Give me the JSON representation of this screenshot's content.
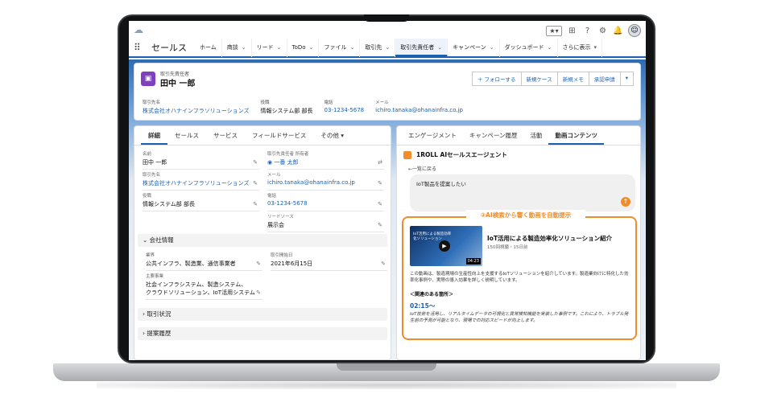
{
  "app": {
    "name": "セールス",
    "nav": [
      "ホーム",
      "商談",
      "リード",
      "ToDo",
      "ファイル",
      "取引先",
      "取引先責任者",
      "キャンペーン",
      "ダッシュボード",
      "さらに表示"
    ],
    "active_nav": "取引先責任者"
  },
  "record": {
    "type": "取引先責任者",
    "name": "田中 一郎",
    "buttons": [
      "＋ フォローする",
      "新規ケース",
      "新規メモ",
      "承認申請"
    ],
    "fields": [
      {
        "label": "取引先名",
        "value": "株式会社オハナインフラソリューションズ"
      },
      {
        "label": "役職",
        "value": "情報システム部 部長"
      },
      {
        "label": "電話",
        "value": "03-1234-5678"
      },
      {
        "label": "メール",
        "value": "ichiro.tanaka@ohanainfra.co.jp"
      }
    ]
  },
  "left": {
    "tabs": [
      "詳細",
      "セールス",
      "サービス",
      "フィールドサービス",
      "その他"
    ],
    "details": {
      "name_label": "名前",
      "name": "田中 一郎",
      "owner_label": "取引先責任者 所有者",
      "owner": "一番 太郎",
      "account_label": "取引先名",
      "account": "株式会社オハナインフラソリューションズ",
      "email_label": "メール",
      "email": "ichiro.tanaka@ohanainfra.co.jp",
      "title_label": "役職",
      "title": "情報システム部 部長",
      "phone_label": "電話",
      "phone": "03-1234-5678",
      "lead_label": "リードソース",
      "lead": "展示会"
    },
    "company_section": "会社情報",
    "company": {
      "industry_label": "業界",
      "industry": "公共インフラ、製造業、通信事業者",
      "start_label": "取引開始日",
      "start": "2021年6月15日",
      "business_label": "主要事業",
      "business_line1": "社会インフラシステム、製造システム、",
      "business_line2": "クラウドソリューション、IoT活用システム"
    },
    "section_status": "取引状況",
    "section_history": "提案履歴"
  },
  "right": {
    "tabs": [
      "エンゲージメント",
      "キャンペーン履歴",
      "活動",
      "動画コンテンツ"
    ],
    "agent_title": "1ROLL AIセールスエージェント",
    "back": "←一覧に戻る",
    "prompt": "IoT製品を提案したい",
    "callout": "②AI検索から響く動画を自動提示",
    "video": {
      "thumb_text": "IoT活用による製造効率化ソリューション",
      "duration": "04:23",
      "title": "IoT活用による製造効率化ソリューション紹介",
      "meta": "150回視聴・15日前",
      "desc": "この動画は、製造現場の生産性向上を支援するIoTソリューションを紹介しています。製造業向けに特化した効率化事例や、実際の導入効果を詳しく説明しています。",
      "section": "＜関連のある箇所＞",
      "time": "02:15〜",
      "note": "IoT技術を活用し、リアルタイムデータの可視化と異常検知機能を実装した事例です。これにより、トラブル発生前の予測が可能となり、現場での対応スピードが向上します。"
    }
  }
}
